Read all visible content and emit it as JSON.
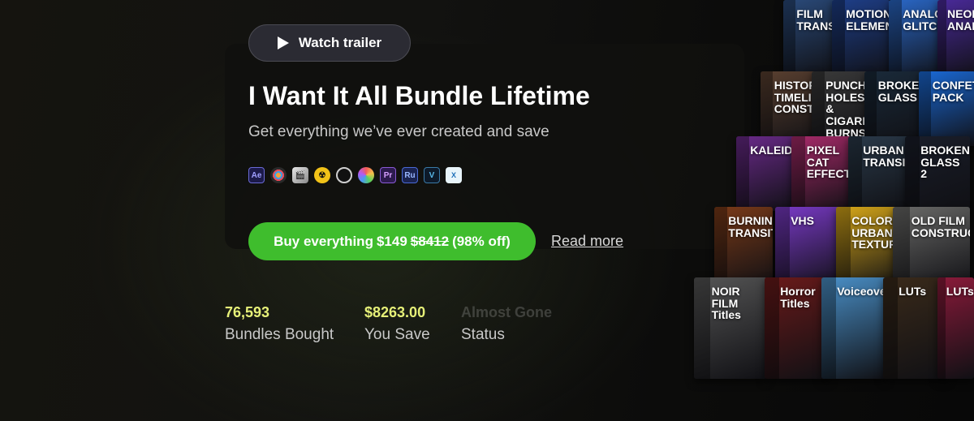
{
  "hero": {
    "watch_trailer_label": "Watch trailer",
    "title": "I Want It All Bundle Lifetime",
    "subtitle": "Get everything we’ve ever created and save",
    "software_icons": [
      {
        "name": "after-effects-icon",
        "text": "Ae"
      },
      {
        "name": "davinci-resolve-icon",
        "text": ""
      },
      {
        "name": "final-cut-pro-icon",
        "text": "🎬"
      },
      {
        "name": "nuke-icon",
        "text": "☢"
      },
      {
        "name": "obs-icon",
        "text": ""
      },
      {
        "name": "photos-icon",
        "text": ""
      },
      {
        "name": "premiere-pro-icon",
        "text": "Pr"
      },
      {
        "name": "premiere-rush-icon",
        "text": "Ru"
      },
      {
        "name": "vegas-icon",
        "text": "V"
      },
      {
        "name": "xpression-icon",
        "text": "X"
      }
    ],
    "buy": {
      "prefix": "Buy everything",
      "price": "$149",
      "old_price": "$8412",
      "discount": "(98% off)"
    },
    "read_more_label": "Read more"
  },
  "stats": [
    {
      "value": "76,593",
      "label": "Bundles Bought"
    },
    {
      "value": "$8263.00",
      "label": "You Save"
    },
    {
      "value": "Almost Gone",
      "label": "Status"
    }
  ],
  "product_boxes": [
    {
      "title": "FILM TRANSITIONS",
      "color": "#2a4a7a"
    },
    {
      "title": "MOTION ELEMENTS",
      "color": "#1e3f8a"
    },
    {
      "title": "ANALOG GLITCH",
      "color": "#2a68c8"
    },
    {
      "title": "NEON ANALOG",
      "color": "#4a2a9a"
    },
    {
      "title": "HISTORY TIMELINE CONSTRUCTOR",
      "color": "#5a4030"
    },
    {
      "title": "PUNCH HOLES & CIGARETTE BURNS",
      "color": "#3a3a3a"
    },
    {
      "title": "BROKEN GLASS",
      "color": "#1a2a3a"
    },
    {
      "title": "CONFETTI PACK",
      "color": "#1a6ad8"
    },
    {
      "title": "KALEIDOSCOPE",
      "color": "#6a2a8a"
    },
    {
      "title": "PIXEL CAT EFFECTS",
      "color": "#a82a6a"
    },
    {
      "title": "URBAN TRANSITIONS",
      "color": "#2a3a4a"
    },
    {
      "title": "BROKEN GLASS 2",
      "color": "#1a1e2a"
    },
    {
      "title": "BURNING TRANSITIONS",
      "color": "#7a3a18"
    },
    {
      "title": "VHS",
      "color": "#7a3ac8"
    },
    {
      "title": "COLORIZE URBAN TEXTURES",
      "color": "#d8a818"
    },
    {
      "title": "OLD FILM CONSTRUCTOR",
      "color": "#6a6a68"
    },
    {
      "title": "NOIR FILM Titles",
      "color": "#555555"
    },
    {
      "title": "Horror Titles",
      "color": "#6a1a1a"
    },
    {
      "title": "Voiceover",
      "color": "#4a90c8"
    },
    {
      "title": "LUTs",
      "color": "#3a2a1a"
    },
    {
      "title": "LUTs",
      "color": "#8a1a3a"
    }
  ]
}
